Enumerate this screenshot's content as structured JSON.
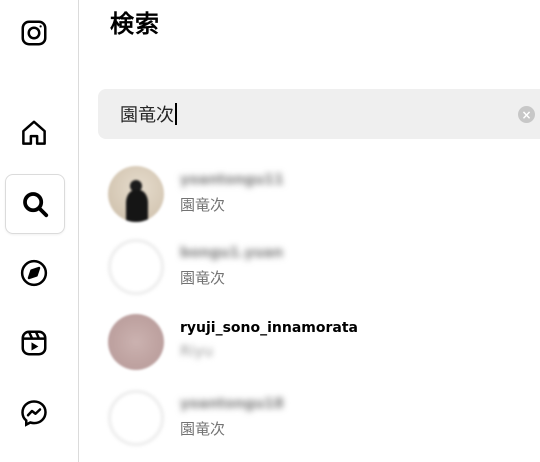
{
  "sidebar": {
    "items": [
      {
        "name": "instagram-icon"
      },
      {
        "name": "home-icon"
      },
      {
        "name": "search-icon",
        "active": true
      },
      {
        "name": "explore-icon"
      },
      {
        "name": "reels-icon"
      },
      {
        "name": "messenger-icon"
      }
    ]
  },
  "panel": {
    "title": "検索"
  },
  "search": {
    "value": "園竜次",
    "clear_icon": "×"
  },
  "results": [
    {
      "username": "yoantongu11",
      "subtitle": "園竜次",
      "avatar": "photo",
      "blurred": true
    },
    {
      "username": "bongu1.yuan",
      "subtitle": "園竜次",
      "avatar": "blank",
      "blurred": true
    },
    {
      "username": "ryuji_sono_innamorata",
      "subtitle": "Riyu",
      "avatar": "pink",
      "blurred": false,
      "subtitle_blurred": true
    },
    {
      "username": "yoantongu18",
      "subtitle": "園竜次",
      "avatar": "blank",
      "blurred": true
    }
  ],
  "colors": {
    "border": "#dbdbdb",
    "search_bg": "#efefef",
    "secondary_text": "#737373"
  }
}
